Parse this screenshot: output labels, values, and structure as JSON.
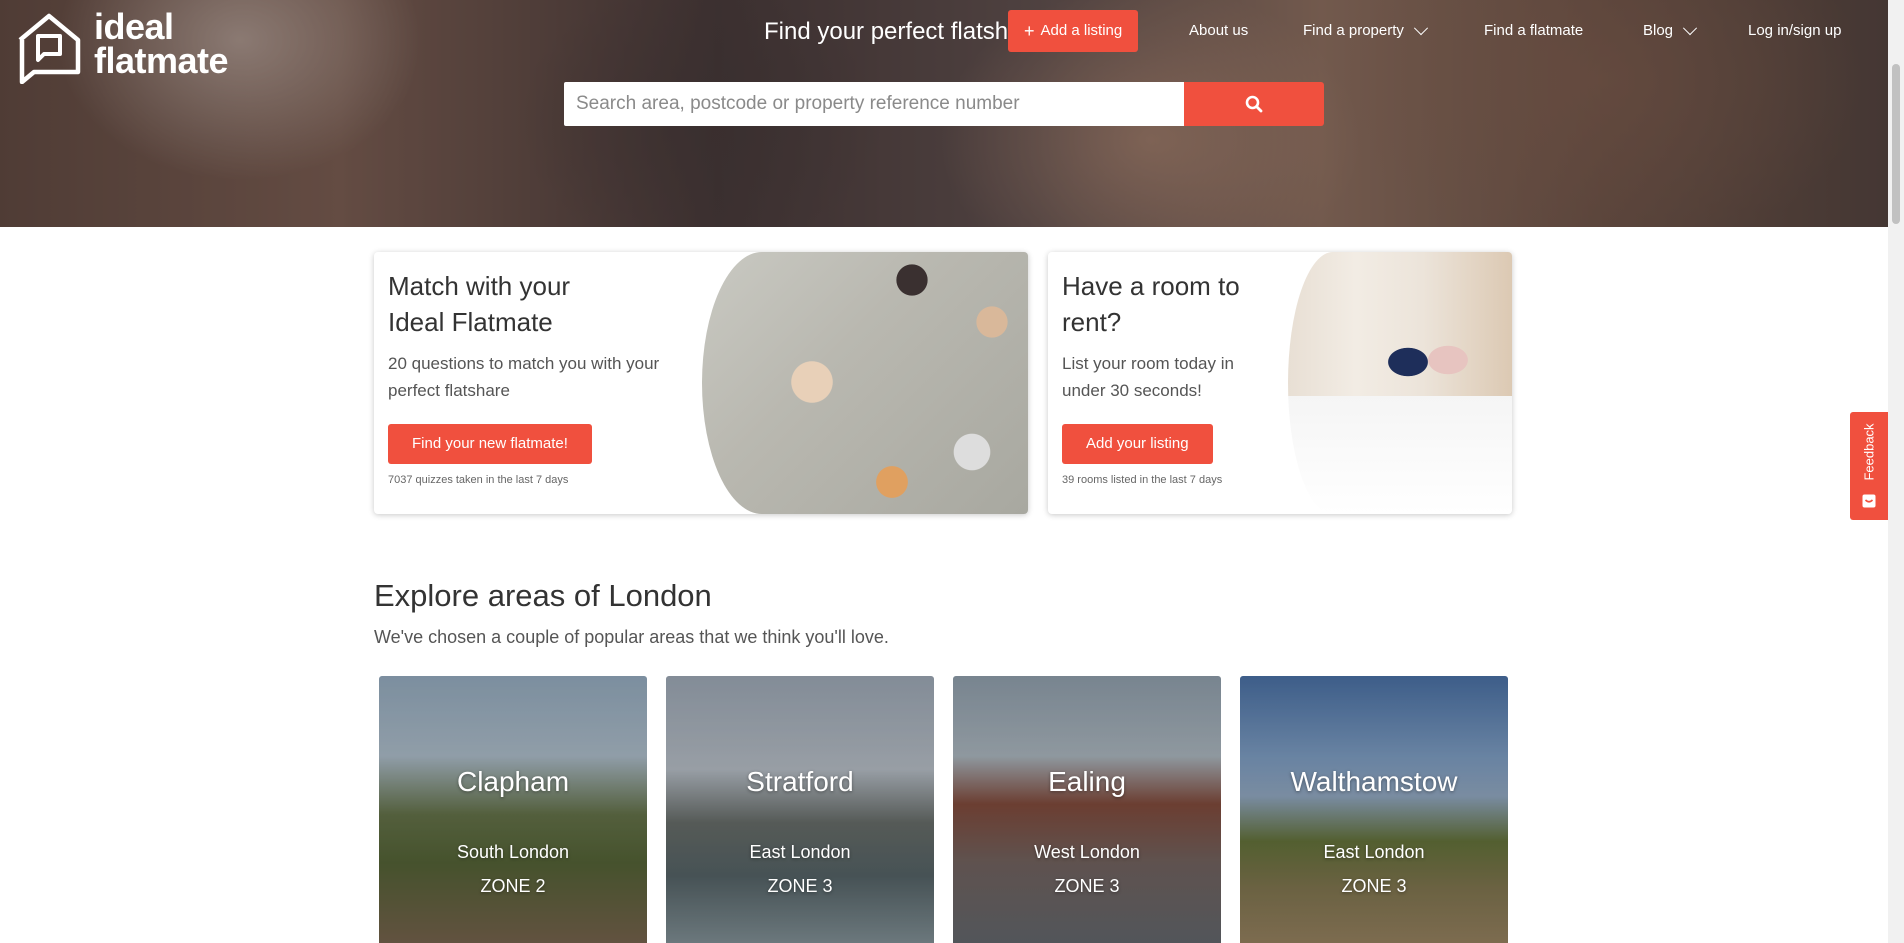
{
  "header": {
    "logo": {
      "line1": "ideal",
      "line2": "flatmate"
    },
    "hero_title": "Find your perfect flatsh",
    "add_listing_label": "Add a listing",
    "nav": [
      {
        "label": "About us"
      },
      {
        "label": "Find a property"
      },
      {
        "label": "Find a flatmate"
      },
      {
        "label": "Blog"
      },
      {
        "label": "Log in/sign up"
      }
    ]
  },
  "search": {
    "placeholder": "Search area, postcode or property reference number"
  },
  "promo": {
    "match": {
      "title_line1": "Match with your",
      "title_line2": "Ideal Flatmate",
      "desc_line1": "20 questions to match you with your",
      "desc_line2": "perfect flatshare",
      "button": "Find your new flatmate!",
      "stat": "7037 quizzes taken in the last 7 days"
    },
    "room": {
      "title_line1": "Have a room to",
      "title_line2": "rent?",
      "desc_line1": "List your room today in",
      "desc_line2": "under 30 seconds!",
      "button": "Add your listing",
      "stat": "39 rooms listed in the last 7 days"
    }
  },
  "explore": {
    "title": "Explore areas of London",
    "subtitle": "We've chosen a couple of popular areas that we think you'll love.",
    "areas": [
      {
        "name": "Clapham",
        "region": "South London",
        "zone": "ZONE 2"
      },
      {
        "name": "Stratford",
        "region": "East London",
        "zone": "ZONE 3"
      },
      {
        "name": "Ealing",
        "region": "West London",
        "zone": "ZONE 3"
      },
      {
        "name": "Walthamstow",
        "region": "East London",
        "zone": "ZONE 3"
      }
    ]
  },
  "feedback": {
    "label": "Feedback"
  },
  "colors": {
    "accent": "#f0503e"
  },
  "icons": [
    "home-chat-logo-icon",
    "plus-icon",
    "chevron-down-icon",
    "search-icon",
    "feedback-icon"
  ]
}
